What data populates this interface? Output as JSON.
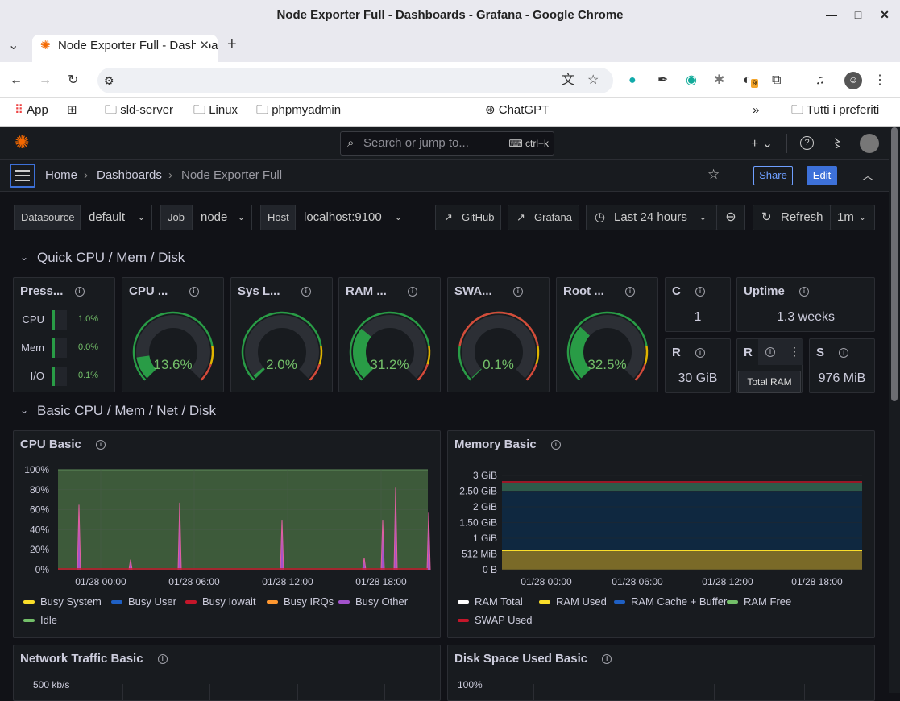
{
  "window": {
    "title": "Node Exporter Full - Dashboards - Grafana - Google Chrome"
  },
  "tab": {
    "title": "Node Exporter Full - Dashboards - Grafana"
  },
  "bookmarks": [
    "App",
    "sld-server",
    "Linux",
    "phpmyadmin",
    "ChatGPT",
    "Tutti i preferiti"
  ],
  "extension_badge": "9",
  "grafana": {
    "search_placeholder": "Search or jump to...",
    "search_shortcut": "ctrl+k",
    "breadcrumb": [
      "Home",
      "Dashboards",
      "Node Exporter Full"
    ],
    "share_label": "Share",
    "edit_label": "Edit",
    "variables": [
      {
        "label": "Datasource",
        "value": "default"
      },
      {
        "label": "Job",
        "value": "node"
      },
      {
        "label": "Host",
        "value": "localhost:9100"
      }
    ],
    "links": [
      "GitHub",
      "Grafana"
    ],
    "time_range": "Last 24 hours",
    "refresh_label": "Refresh",
    "refresh_interval": "1m"
  },
  "rows": [
    "Quick CPU / Mem / Disk",
    "Basic CPU / Mem / Net / Disk"
  ],
  "pressure": {
    "title": "Press...",
    "items": [
      {
        "label": "CPU",
        "value": "1.0%",
        "level": 0.01
      },
      {
        "label": "Mem",
        "value": "0.0%",
        "level": 0.0
      },
      {
        "label": "I/O",
        "value": "0.1%",
        "level": 0.001
      }
    ]
  },
  "gauges": [
    {
      "title": "CPU ...",
      "value": "13.6%",
      "level": 0.136
    },
    {
      "title": "Sys L...",
      "value": "2.0%",
      "level": 0.02
    },
    {
      "title": "RAM ...",
      "value": "31.2%",
      "level": 0.312
    },
    {
      "title": "SWA...",
      "value": "0.1%",
      "level": 0.001
    },
    {
      "title": "Root ...",
      "value": "32.5%",
      "level": 0.325
    }
  ],
  "stats": {
    "cores": {
      "title": "C",
      "value": "1"
    },
    "uptime": {
      "title": "Uptime",
      "value": "1.3 weeks"
    },
    "rootfs": {
      "title": "R",
      "value": "30 GiB"
    },
    "ram": {
      "title": "R"
    },
    "swap": {
      "title": "S",
      "value": "976 MiB"
    },
    "tooltip": "Total RAM"
  },
  "colors": {
    "accent": "#3d71d9",
    "green": "#299c46",
    "red": "#d44a3a",
    "yellow": "#fade2a",
    "blue": "#1f60c4"
  },
  "cpu_panel": {
    "title": "CPU Basic"
  },
  "mem_panel": {
    "title": "Memory Basic"
  },
  "net_panel": {
    "title": "Network Traffic Basic",
    "ytick": "500 kb/s"
  },
  "disk_panel": {
    "title": "Disk Space Used Basic",
    "ytick": "100%"
  },
  "chart_data": [
    {
      "type": "area",
      "title": "CPU Basic",
      "x": [
        "01/28 00:00",
        "01/28 06:00",
        "01/28 12:00",
        "01/28 18:00"
      ],
      "yticks": [
        "100%",
        "80%",
        "60%",
        "40%",
        "20%",
        "0%"
      ],
      "ylim": [
        0,
        100
      ],
      "series": [
        {
          "name": "Busy System",
          "color": "#fade2a"
        },
        {
          "name": "Busy User",
          "color": "#1f60c4"
        },
        {
          "name": "Busy Iowait",
          "color": "#c4162a"
        },
        {
          "name": "Busy IRQs",
          "color": "#ff9830"
        },
        {
          "name": "Busy Other",
          "color": "#a352cc"
        },
        {
          "name": "Idle",
          "color": "#73bf69",
          "values_approx": [
            99,
            98,
            99,
            99
          ]
        }
      ]
    },
    {
      "type": "area",
      "title": "Memory Basic",
      "x": [
        "01/28 00:00",
        "01/28 06:00",
        "01/28 12:00",
        "01/28 18:00"
      ],
      "yticks": [
        "3 GiB",
        "2.50 GiB",
        "2 GiB",
        "1.50 GiB",
        "1 GiB",
        "512 MiB",
        "0 B"
      ],
      "series": [
        {
          "name": "RAM Total",
          "color": "#ffffff"
        },
        {
          "name": "RAM Used",
          "color": "#fade2a"
        },
        {
          "name": "RAM Cache + Buffer",
          "color": "#1f60c4"
        },
        {
          "name": "RAM Free",
          "color": "#73bf69"
        },
        {
          "name": "SWAP Used",
          "color": "#c4162a"
        }
      ]
    }
  ]
}
